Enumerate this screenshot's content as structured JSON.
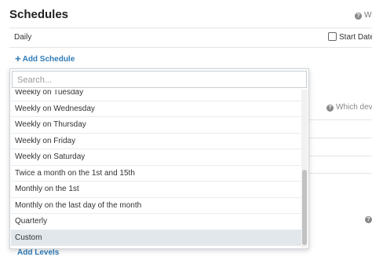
{
  "section": {
    "title": "Schedules",
    "help_partial": "W"
  },
  "row": {
    "label": "Daily",
    "start_date_label": "Start Date"
  },
  "add_schedule": "+ Add Schedule",
  "add_schedule_text": "Add Schedule",
  "background": {
    "which_device": "Which devi",
    "add_levels": "Add Levels"
  },
  "dropdown": {
    "search_placeholder": "Search...",
    "options": [
      "Weekly on Tuesday",
      "Weekly on Wednesday",
      "Weekly on Thursday",
      "Weekly on Friday",
      "Weekly on Saturday",
      "Twice a month on the 1st and 15th",
      "Monthly on the 1st",
      "Monthly on the last day of the month",
      "Quarterly",
      "Custom"
    ],
    "highlighted": "Custom"
  },
  "icons": {
    "help": "question-circle-icon",
    "plus": "plus-icon"
  },
  "colors": {
    "link": "#2f7bb7",
    "highlight": "#e1e7ea"
  }
}
